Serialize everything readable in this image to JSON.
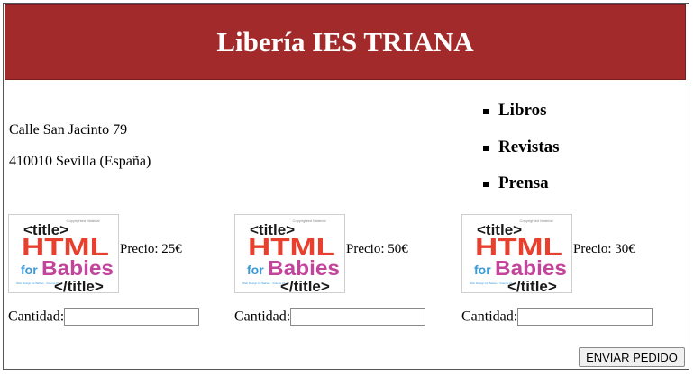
{
  "header": {
    "title": "Libería IES TRIANA"
  },
  "address": {
    "line1": "Calle San Jacinto 79",
    "line2": "410010 Sevilla (España)"
  },
  "nav": {
    "items": [
      "Libros",
      "Revistas",
      "Prensa"
    ]
  },
  "book_cover": {
    "small_top": "Copyrighted Material",
    "open_tag": "<title>",
    "word1": "HTML",
    "word2a": "for",
    "word2b": "Babies",
    "close_tag": "</title>",
    "small_bottom": "Web Design for Babies · Volume 01",
    "colors": {
      "html": "#e8402f",
      "for": "#3a9ad9",
      "babies": "#c2449b",
      "tags": "#1a1a1a"
    }
  },
  "products": [
    {
      "price_label": "Precio: 25€"
    },
    {
      "price_label": "Precio: 50€"
    },
    {
      "price_label": "Precio: 30€"
    }
  ],
  "quantity": {
    "label": "Cantidad:",
    "value": ""
  },
  "actions": {
    "submit_label": "ENVIAR PEDIDO"
  },
  "colors": {
    "header_bg": "#a22a2a",
    "header_text": "#ffffff"
  }
}
